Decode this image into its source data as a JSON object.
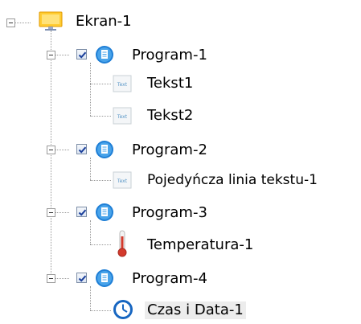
{
  "tree": {
    "root": {
      "label": "Ekran-1",
      "icon": "screen-icon"
    },
    "programs": [
      {
        "label": "Program-1",
        "checked": true,
        "icon": "program-icon",
        "children": [
          {
            "label": "Tekst1",
            "icon": "text-icon"
          },
          {
            "label": "Tekst2",
            "icon": "text-icon"
          }
        ]
      },
      {
        "label": "Program-2",
        "checked": true,
        "icon": "program-icon",
        "children": [
          {
            "label": "Pojedyńcza linia tekstu-1",
            "icon": "text-icon"
          }
        ]
      },
      {
        "label": "Program-3",
        "checked": true,
        "icon": "program-icon",
        "children": [
          {
            "label": "Temperatura-1",
            "icon": "thermometer-icon"
          }
        ]
      },
      {
        "label": "Program-4",
        "checked": true,
        "icon": "program-icon",
        "children": [
          {
            "label": "Czas i Data-1",
            "icon": "clock-icon",
            "selected": true
          }
        ]
      }
    ],
    "text_icon_caption": "Text"
  }
}
